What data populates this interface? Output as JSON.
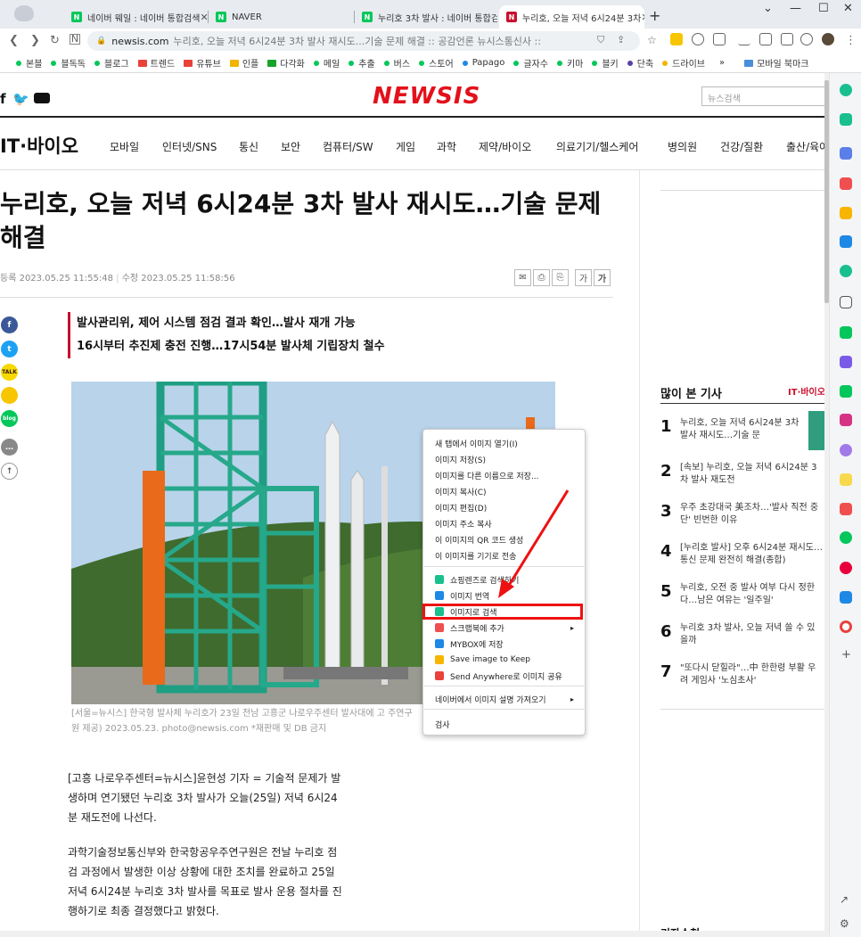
{
  "browser": {
    "tabs": [
      {
        "label": "네이버 웨일 : 네이버 통합검색",
        "favicon": "N"
      },
      {
        "label": "NAVER",
        "favicon": "N"
      },
      {
        "label": "누리호 3차 발사 : 네이버 통합검",
        "favicon": "N"
      },
      {
        "label": "누리호, 오늘 저녁 6시24분 3차",
        "favicon": "N"
      }
    ],
    "new_tab": "+",
    "url_domain": "newsis.com",
    "url_rest": "누리호, 오늘 저녁 6시24분 3차 발사 재시도...기술 문제 해결 :: 공감언론 뉴시스통신사 ::",
    "bookmarks": [
      {
        "label": "본블",
        "color": "#03c75a",
        "kind": "dot"
      },
      {
        "label": "블독독",
        "color": "#03c75a",
        "kind": "dot"
      },
      {
        "label": "블로그",
        "color": "#03c75a",
        "kind": "dot"
      },
      {
        "label": "트렌드",
        "color": "#e8423b",
        "kind": "folder"
      },
      {
        "label": "유튜브",
        "color": "#e8423b",
        "kind": "folder"
      },
      {
        "label": "인플",
        "color": "#f2b400",
        "kind": "folder"
      },
      {
        "label": "다각화",
        "color": "#17a329",
        "kind": "folder"
      },
      {
        "label": "메일",
        "color": "#03c75a",
        "kind": "dot"
      },
      {
        "label": "추출",
        "color": "#03c75a",
        "kind": "dot"
      },
      {
        "label": "버스",
        "color": "#03c75a",
        "kind": "dot"
      },
      {
        "label": "스토어",
        "color": "#03c75a",
        "kind": "dot"
      },
      {
        "label": "Papago",
        "color": "#1e88e5",
        "kind": "dot"
      },
      {
        "label": "글자수",
        "color": "#03c75a",
        "kind": "dot"
      },
      {
        "label": "키마",
        "color": "#03c75a",
        "kind": "dot"
      },
      {
        "label": "블키",
        "color": "#03c75a",
        "kind": "dot"
      },
      {
        "label": "단축",
        "color": "#5b3fa8",
        "kind": "dot"
      },
      {
        "label": "드라이브",
        "color": "#f2b400",
        "kind": "dot"
      }
    ],
    "bookmarks_more": "»",
    "mobile_bookmarks": "모바일 북마크"
  },
  "site": {
    "logo": "NEWSIS",
    "search_placeholder": "뉴스검색",
    "section": "IT·바이오",
    "categories": [
      "모바일",
      "인터넷/SNS",
      "통신",
      "보안",
      "컴퓨터/SW",
      "게임",
      "과학",
      "제약/바이오",
      "의료기기/헬스케어",
      "병의원",
      "건강/질환",
      "출산/육아"
    ]
  },
  "article": {
    "headline": "누리호, 오늘 저녁 6시24분 3차 발사 재시도…기술 문제 해결",
    "meta_registered": "등록 2023.05.25 11:55:48",
    "meta_modified": "수정 2023.05.25 11:58:56",
    "font_small": "가",
    "font_large": "가",
    "summary": [
      "발사관리위, 제어 시스템 점검 결과 확인…발사 재개 가능",
      "16시부터 추진제 충전 진행…17시54분 발사체 기립장치 철수"
    ],
    "caption": "[서울=뉴시스] 한국형 발사체 누리호가 23일 전남 고흥군 나로우주센터 발사대에 고 주연구원 제공) 2023.05.23. photo@newsis.com *재판매 및 DB 금지",
    "paragraph1": "[고흥 나로우주센터=뉴시스]윤현성 기자 = 기술적 문제가 발생하며 연기됐던 누리호 3차 발사가 오늘(25일) 저녁 6시24분 재도전에 나선다.",
    "paragraph2": "과학기술정보통신부와 한국항공우주연구원은 전날 누리호 점검 과정에서 발생한 이상 상황에 대한 조치를 완료하고 25일 저녁 6시24분 누리호 3차 발사를 목표로 발사 운용 절차를 진행하기로 최종 결정했다고 밝혔다."
  },
  "most_read": {
    "title": "많이 본 기사",
    "tab": "IT·바이오",
    "items": [
      {
        "rank": "1",
        "text": "누리호, 오늘 저녁 6시24분 3차 발사 재시도…기술 문"
      },
      {
        "rank": "2",
        "text": "[속보] 누리호, 오늘 저녁 6시24분 3차 발사 재도전"
      },
      {
        "rank": "3",
        "text": "우주 초강대국 美조차…'발사 직전 중단' 빈번한 이유"
      },
      {
        "rank": "4",
        "text": "[누리호 발사] 오후 6시24분 재시도…통신 문제 완전히 해결(종합)"
      },
      {
        "rank": "5",
        "text": "누리호, 오전 중 발사 여부 다시 정한다…남은 여유는 '일주일'"
      },
      {
        "rank": "6",
        "text": "누리호 3차 발사, 오늘 저녁 쏠 수 있을까"
      },
      {
        "rank": "7",
        "text": "\"또다시 닫힐라\"…中 한한령 부활 우려 게임사 '노심초사'"
      }
    ],
    "reporter_title": "기자수첩"
  },
  "context_menu": {
    "items": [
      {
        "label": "새 탭에서 이미지 열기(I)",
        "icon": "",
        "color": ""
      },
      {
        "label": "이미지 저장(S)",
        "icon": "",
        "color": ""
      },
      {
        "label": "이미지를 다른 이름으로 저장...",
        "icon": "",
        "color": ""
      },
      {
        "label": "이미지 복사(C)",
        "icon": "",
        "color": ""
      },
      {
        "label": "이미지 편집(D)",
        "icon": "",
        "color": ""
      },
      {
        "label": "이미지 주소 복사",
        "icon": "",
        "color": ""
      },
      {
        "label": "이 이미지의 QR 코드 생성",
        "icon": "",
        "color": ""
      },
      {
        "label": "이 이미지를 기기로 전송",
        "icon": "",
        "color": ""
      },
      {
        "label": "쇼핑렌즈로 검색하기",
        "icon": "shopping-lens-icon",
        "color": "#18c08f"
      },
      {
        "label": "이미지 번역",
        "icon": "papago-icon",
        "color": "#1e88e5"
      },
      {
        "label": "이미지로 검색",
        "icon": "lens-search-icon",
        "color": "#18c08f"
      },
      {
        "label": "스크랩북에 추가",
        "icon": "scrapbook-icon",
        "color": "#ef4f4f"
      },
      {
        "label": "MYBOX에 저장",
        "icon": "mybox-icon",
        "color": "#1e88e5"
      },
      {
        "label": "Save image to Keep",
        "icon": "keep-icon",
        "color": "#f7b500"
      },
      {
        "label": "Send Anywhere로 이미지 공유",
        "icon": "send-anywhere-icon",
        "color": "#e8423b"
      },
      {
        "label": "네이버에서 이미지 설명 가져오기",
        "icon": "",
        "color": ""
      },
      {
        "label": "검사",
        "icon": "",
        "color": ""
      }
    ],
    "highlighted": "이미지로 검색"
  },
  "colors": {
    "brand": "#e3111b",
    "highlight": "#e11111",
    "section_tab": "#c8102e"
  }
}
